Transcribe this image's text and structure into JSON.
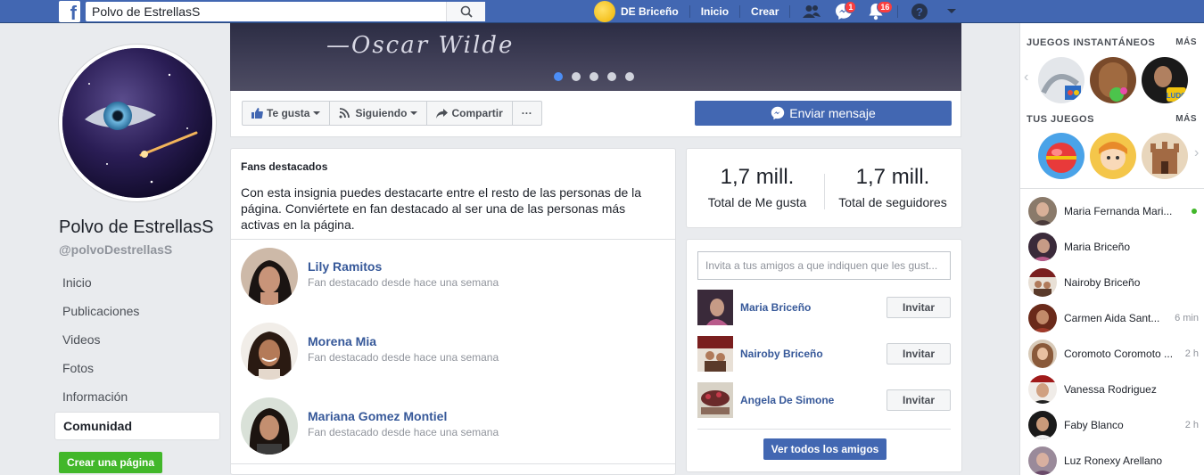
{
  "topbar": {
    "search_value": "Polvo de EstrellasS",
    "user_name": "DE Briceño",
    "links": [
      "Inicio",
      "Crear"
    ],
    "messages_count": "1",
    "notifications_count": "16"
  },
  "page": {
    "name": "Polvo de EstrellasS",
    "handle": "@polvoDestrellasS",
    "cover_quote": "—Oscar Wilde",
    "nav": [
      "Inicio",
      "Publicaciones",
      "Videos",
      "Fotos",
      "Información",
      "Comunidad"
    ],
    "create_page": "Crear una página"
  },
  "actions": {
    "like": "Te gusta",
    "following": "Siguiendo",
    "share": "Compartir",
    "more": "···",
    "message": "Enviar mensaje"
  },
  "fans": {
    "title": "Fans destacados",
    "description": "Con esta insignia puedes destacarte entre el resto de las personas de la página. Conviértete en fan destacado al ser una de las personas más activas en la página.",
    "items": [
      {
        "name": "Lily Ramitos",
        "sub": "Fan destacado desde hace una semana"
      },
      {
        "name": "Morena Mia",
        "sub": "Fan destacado desde hace una semana"
      },
      {
        "name": "Mariana Gomez Montiel",
        "sub": "Fan destacado desde hace una semana"
      }
    ]
  },
  "stats": {
    "likes_value": "1,7 mill.",
    "likes_label": "Total de Me gusta",
    "followers_value": "1,7 mill.",
    "followers_label": "Total de seguidores"
  },
  "invite": {
    "placeholder": "Invita a tus amigos a que indiquen que les gust...",
    "button": "Invitar",
    "friends": [
      "Maria Briceño",
      "Nairoby Briceño",
      "Angela De Simone"
    ],
    "see_all": "Ver todos los amigos"
  },
  "sidebar": {
    "instant_games": "JUEGOS INSTANTÁNEOS",
    "your_games": "TUS JUEGOS",
    "more": "MÁS",
    "contacts": [
      {
        "name": "Maria Fernanda Mari...",
        "time": ""
      },
      {
        "name": "Maria Briceño",
        "time": ""
      },
      {
        "name": "Nairoby Briceño",
        "time": ""
      },
      {
        "name": "Carmen Aida Sant...",
        "time": "6 min"
      },
      {
        "name": "Coromoto Coromoto ...",
        "time": "2 h"
      },
      {
        "name": "Vanessa Rodriguez",
        "time": ""
      },
      {
        "name": "Faby Blanco",
        "time": "2 h"
      },
      {
        "name": "Luz Ronexy Arellano",
        "time": ""
      }
    ]
  }
}
